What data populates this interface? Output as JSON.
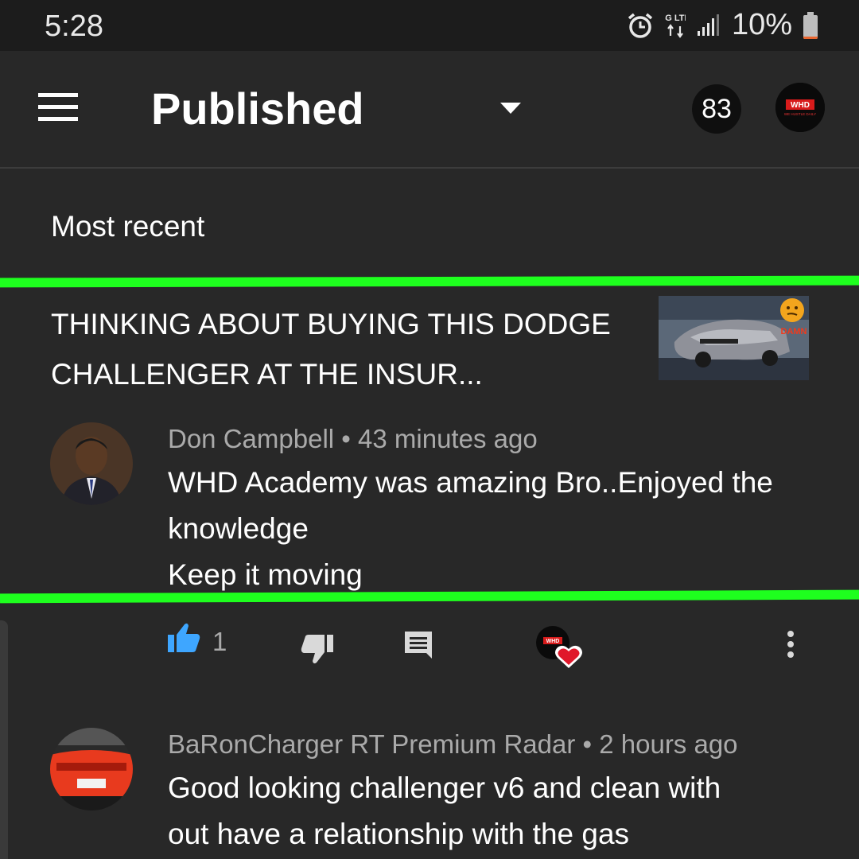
{
  "status_bar": {
    "time": "5:28",
    "battery_percent": "10%",
    "battery_level": 0.1,
    "network_label": "4G LTE",
    "icons": [
      "alarm-icon",
      "network-4g-icon",
      "signal-icon",
      "battery-icon"
    ]
  },
  "header": {
    "title": "Published",
    "menu_icon": "hamburger-menu-icon",
    "dropdown_icon": "chevron-down-icon",
    "notification_count": "83",
    "channel_logo_text": "WHD",
    "channel_logo_subtext": "WE HUSTLE DAILY"
  },
  "sort": {
    "label": "Most recent"
  },
  "video": {
    "title": "THINKING ABOUT BUYING THIS DODGE CHALLENGER AT THE INSUR...",
    "thumbnail_text": "DAMN"
  },
  "comments": [
    {
      "author": "Don Campbell",
      "time": "43 minutes ago",
      "lines": [
        "WHD Academy was amazing Bro..Enjoyed the knowledge",
        "Keep it moving"
      ],
      "like_count": "1"
    },
    {
      "author": "BaRonCharger RT Premium Radar",
      "time": "2 hours ago",
      "lines": [
        "Good looking challenger v6 and clean with out have  a relationship with the gas"
      ]
    }
  ],
  "colors": {
    "background": "#282828",
    "highlight_green": "#1eff1e",
    "like_blue": "#3ea6ff",
    "heart_red": "#e0182b"
  }
}
